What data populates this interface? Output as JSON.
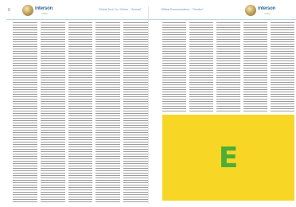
{
  "left_page": {
    "page_number": "8",
    "logo": {
      "icon": "globe-icon",
      "name": "interson",
      "tagline": "online"
    },
    "running_head": "Global Tech Co. Online · \"Annual\"",
    "column_count": 5
  },
  "right_page": {
    "running_head": "Official Documentation · \"Section\"",
    "logo": {
      "icon": "globe-icon",
      "name": "interson",
      "tagline": "online"
    },
    "column_count": 5,
    "advertisement": {
      "letter": "E",
      "background_color": "#f7d626",
      "letter_color": "#4cae36"
    }
  },
  "colors": {
    "header_rule": "#bcd4e4",
    "text_lines": "#9c9c9c",
    "logo_text": "#2f6a96"
  }
}
